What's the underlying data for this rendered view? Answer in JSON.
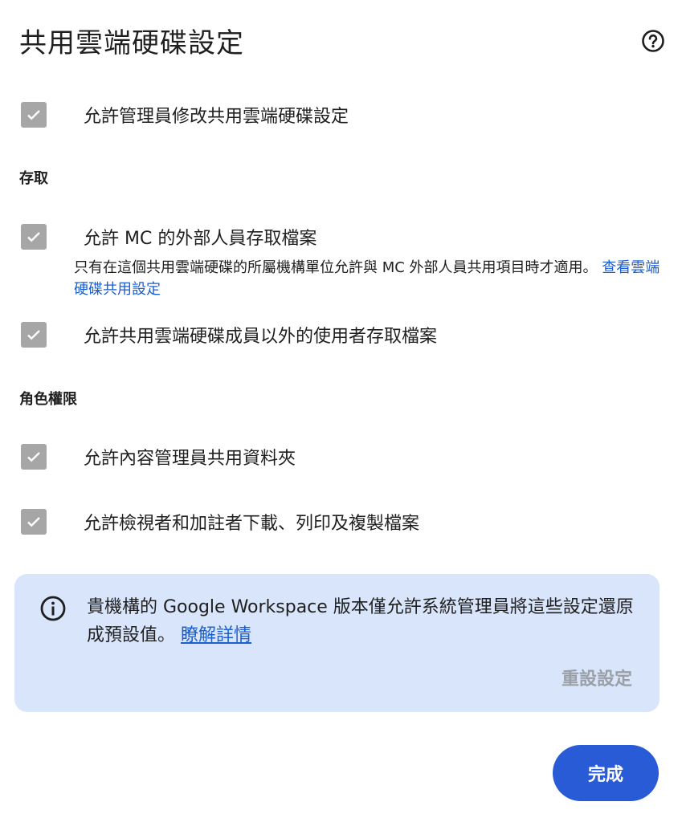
{
  "title": "共用雲端硬碟設定",
  "icons": {
    "help": "help-circle-icon",
    "check": "check-icon",
    "info": "info-icon"
  },
  "options": {
    "allow_admin_modify": "允許管理員修改共用雲端硬碟設定",
    "allow_external_mc": "允許 MC 的外部人員存取檔案",
    "allow_non_members": "允許共用雲端硬碟成員以外的使用者存取檔案",
    "allow_content_managers_share_folders": "允許內容管理員共用資料夾",
    "allow_viewers_download": "允許檢視者和加註者下載、列印及複製檔案"
  },
  "checked": {
    "allow_admin_modify": true,
    "allow_external_mc": true,
    "allow_non_members": true,
    "allow_content_managers_share_folders": true,
    "allow_viewers_download": true
  },
  "sections": {
    "access": "存取",
    "roles": "角色權限"
  },
  "external_note": {
    "text": "只有在這個共用雲端硬碟的所屬機構單位允許與 MC 外部人員共用項目時才適用。 ",
    "link": "查看雲端硬碟共用設定"
  },
  "banner": {
    "text": "貴機構的 Google Workspace 版本僅允許系統管理員將這些設定還原成預設值。 ",
    "link": "瞭解詳情",
    "reset_label": "重設設定"
  },
  "done_label": "完成",
  "colors": {
    "checkbox_disabled": "#a6a6a6",
    "banner_bg": "#d9e5fb",
    "link": "#1a5ecf",
    "primary": "#2a5bd7"
  }
}
